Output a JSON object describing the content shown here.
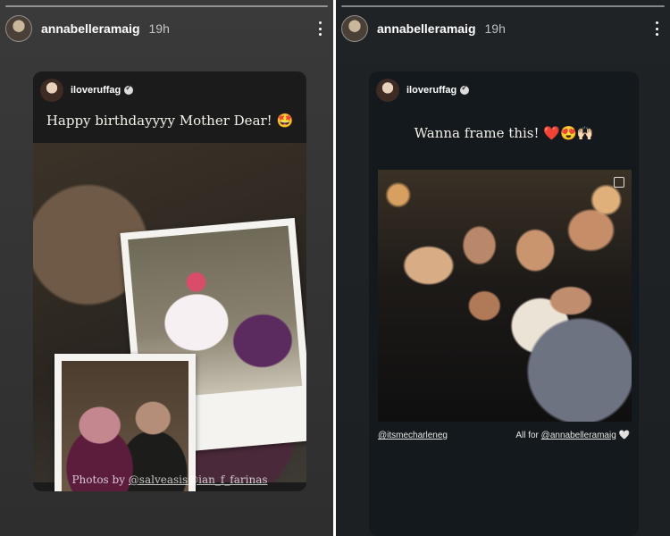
{
  "left_story": {
    "username": "annabelleramaig",
    "time": "19h",
    "post": {
      "author": "iloveruffag",
      "caption": "Happy birthdayyyy Mother Dear! 🤩",
      "credit_prefix": "Photos by ",
      "credit_mention_1": "@salveasis",
      "credit_mention_2": "@ian_f_farinas"
    }
  },
  "right_story": {
    "username": "annabelleramaig",
    "time": "19h",
    "post": {
      "author": "iloveruffag",
      "caption": "Wanna frame this! ❤️😍🙌🏻",
      "tag_left": "@itsmecharleneg",
      "tag_right_prefix": "All for ",
      "tag_right_mention": "@annabelleramaig",
      "tag_right_suffix": " 🤍"
    }
  },
  "icons": {
    "more": "more-vertical-icon",
    "verified": "verified-badge-icon",
    "multi_photo": "multi-photo-icon"
  },
  "colors": {
    "left_bg": "#333333",
    "right_bg": "#1e2224",
    "text": "#ffffff"
  }
}
